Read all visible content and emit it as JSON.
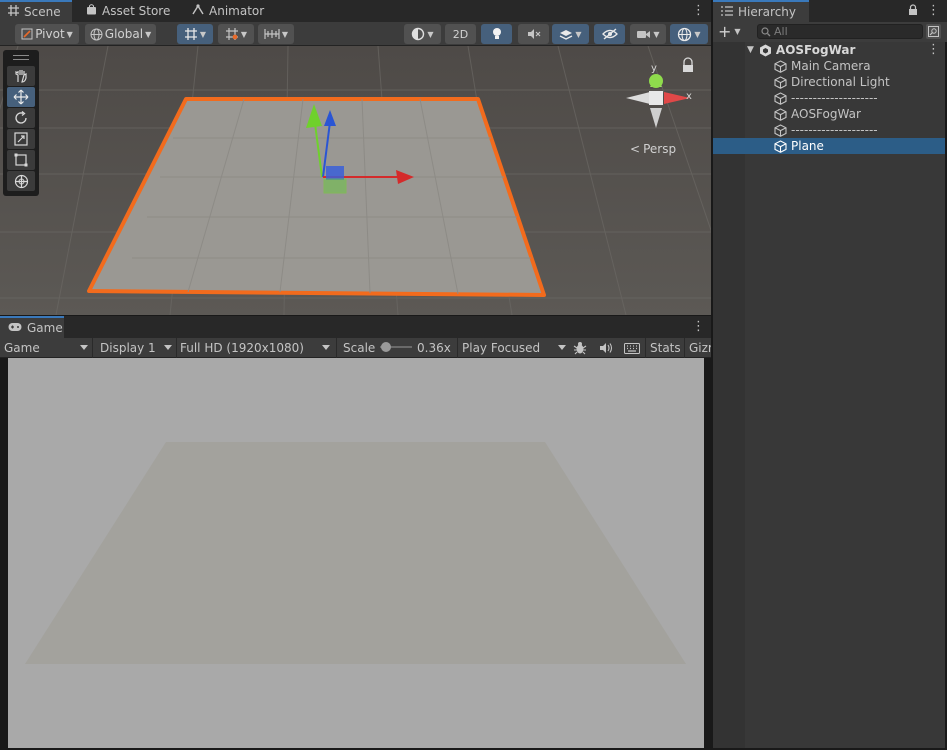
{
  "colors": {
    "accent": "#3a79bb",
    "selection": "#2c5d87",
    "outline": "#f26b1d",
    "axis_x": "#d42b2b",
    "axis_y": "#6fd12c",
    "axis_z": "#2a55d4",
    "game_bg": "#a9a9a9",
    "plane": "#a3a29d"
  },
  "scene": {
    "tabs": [
      {
        "label": "Scene",
        "icon": "grid-icon"
      },
      {
        "label": "Asset Store",
        "icon": "bag-icon"
      },
      {
        "label": "Animator",
        "icon": "animator-icon"
      }
    ],
    "toolbar": {
      "pivot_label": "Pivot",
      "global_label": "Global",
      "mode_2d_label": "2D"
    },
    "persp_label": "Persp",
    "gizmo_axes": {
      "x": "x",
      "y": "y"
    }
  },
  "game": {
    "tab_label": "Game",
    "toolbar": {
      "view_label": "Game",
      "display_label": "Display 1",
      "resolution_label": "Full HD (1920x1080)",
      "scale_label": "Scale",
      "scale_value": "0.36x",
      "play_mode_label": "Play Focused",
      "stats_label": "Stats",
      "gizmos_label": "Gizm"
    }
  },
  "hierarchy": {
    "tab_label": "Hierarchy",
    "search_placeholder": "All",
    "scene_name": "AOSFogWar",
    "items": [
      {
        "label": "Main Camera",
        "selected": false
      },
      {
        "label": "Directional Light",
        "selected": false
      },
      {
        "label": "--------------------",
        "selected": false
      },
      {
        "label": "AOSFogWar",
        "selected": false
      },
      {
        "label": "--------------------",
        "selected": false
      },
      {
        "label": "Plane",
        "selected": true
      }
    ]
  }
}
